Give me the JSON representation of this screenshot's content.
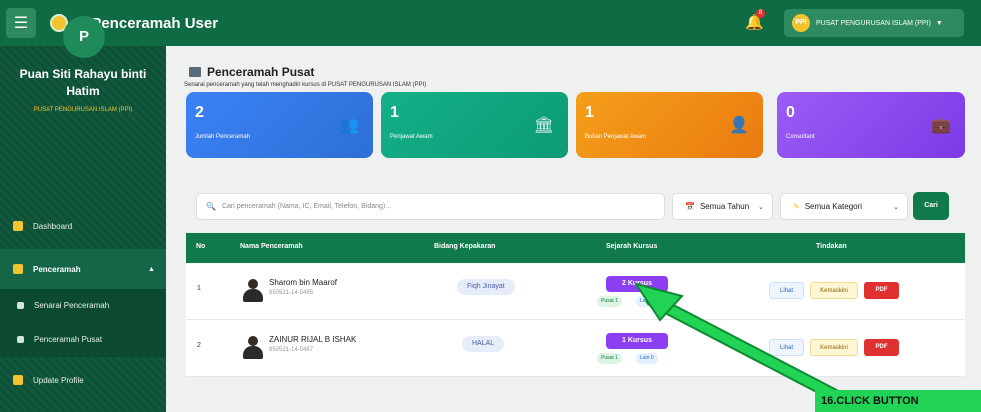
{
  "header": {
    "menu_icon": "☰",
    "app_title": "e-Penceramah User",
    "bell_icon": "bell-icon",
    "bell_badge": "8",
    "user_initials": "PPI",
    "user_label": "PUSAT PENGURUSAN ISLAM (PPI)",
    "user_caret": "▼"
  },
  "sidebar": {
    "avatar_letter": "P",
    "name_line1": "Puan Siti Rahayu binti",
    "name_line2": "Hatim",
    "org": "PUSAT PENGURUSAN ISLAM (PPI)",
    "items": [
      {
        "label": "Dashboard"
      },
      {
        "label": "Penceramah"
      },
      {
        "label": "Senarai Penceramah"
      },
      {
        "label": "Penceramah Pusat"
      },
      {
        "label": "Update Profile"
      }
    ],
    "penceramah_caret": "▲"
  },
  "page": {
    "title": "Penceramah Pusat",
    "subtitle": "Senarai penceramah yang telah menghadiri kursus di PUSAT PENGURUSAN ISLAM (PPI)"
  },
  "cards": [
    {
      "value": "2",
      "label": "Jumlah Penceramah",
      "icon": "users-icon"
    },
    {
      "value": "1",
      "label": "Penjawat Awam",
      "icon": "building-icon"
    },
    {
      "value": "1",
      "label": "Bukan Penjawat Awam",
      "icon": "user-icon"
    },
    {
      "value": "0",
      "label": "Consultant",
      "icon": "briefcase-icon"
    }
  ],
  "filters": {
    "search_placeholder": "Cari penceramah (Nama, IC, Email, Telefon, Bidang)...",
    "year_value": "Semua Tahun",
    "category_value": "Semua Kategori",
    "search_button": "Cari"
  },
  "table": {
    "headers": [
      "No",
      "Nama Penceramah",
      "Bidang Kepakaran",
      "Sejarah Kursus",
      "Tindakan"
    ],
    "rows": [
      {
        "no": "1",
        "name": "Sharom bin Maarof",
        "ic": "850521-14-5485",
        "bidang": "Fiqh Jinayat",
        "kursus": "2 Kursus",
        "pusat": "Pusat 1",
        "lain": "Lain 1",
        "lihat": "Lihat",
        "kemaskini": "Kemaskini",
        "pdf": "PDF"
      },
      {
        "no": "2",
        "name": "ZAINUR RIJAL B ISHAK",
        "ic": "850521-14-5487",
        "bidang": "HALAL",
        "kursus": "1 Kursus",
        "pusat": "Pusat 1",
        "lain": "Lain 0",
        "lihat": "Lihat",
        "kemaskini": "Kemaskini",
        "pdf": "PDF"
      }
    ]
  },
  "annotation": {
    "label": "16.CLICK BUTTON",
    "color": "#22d455"
  }
}
